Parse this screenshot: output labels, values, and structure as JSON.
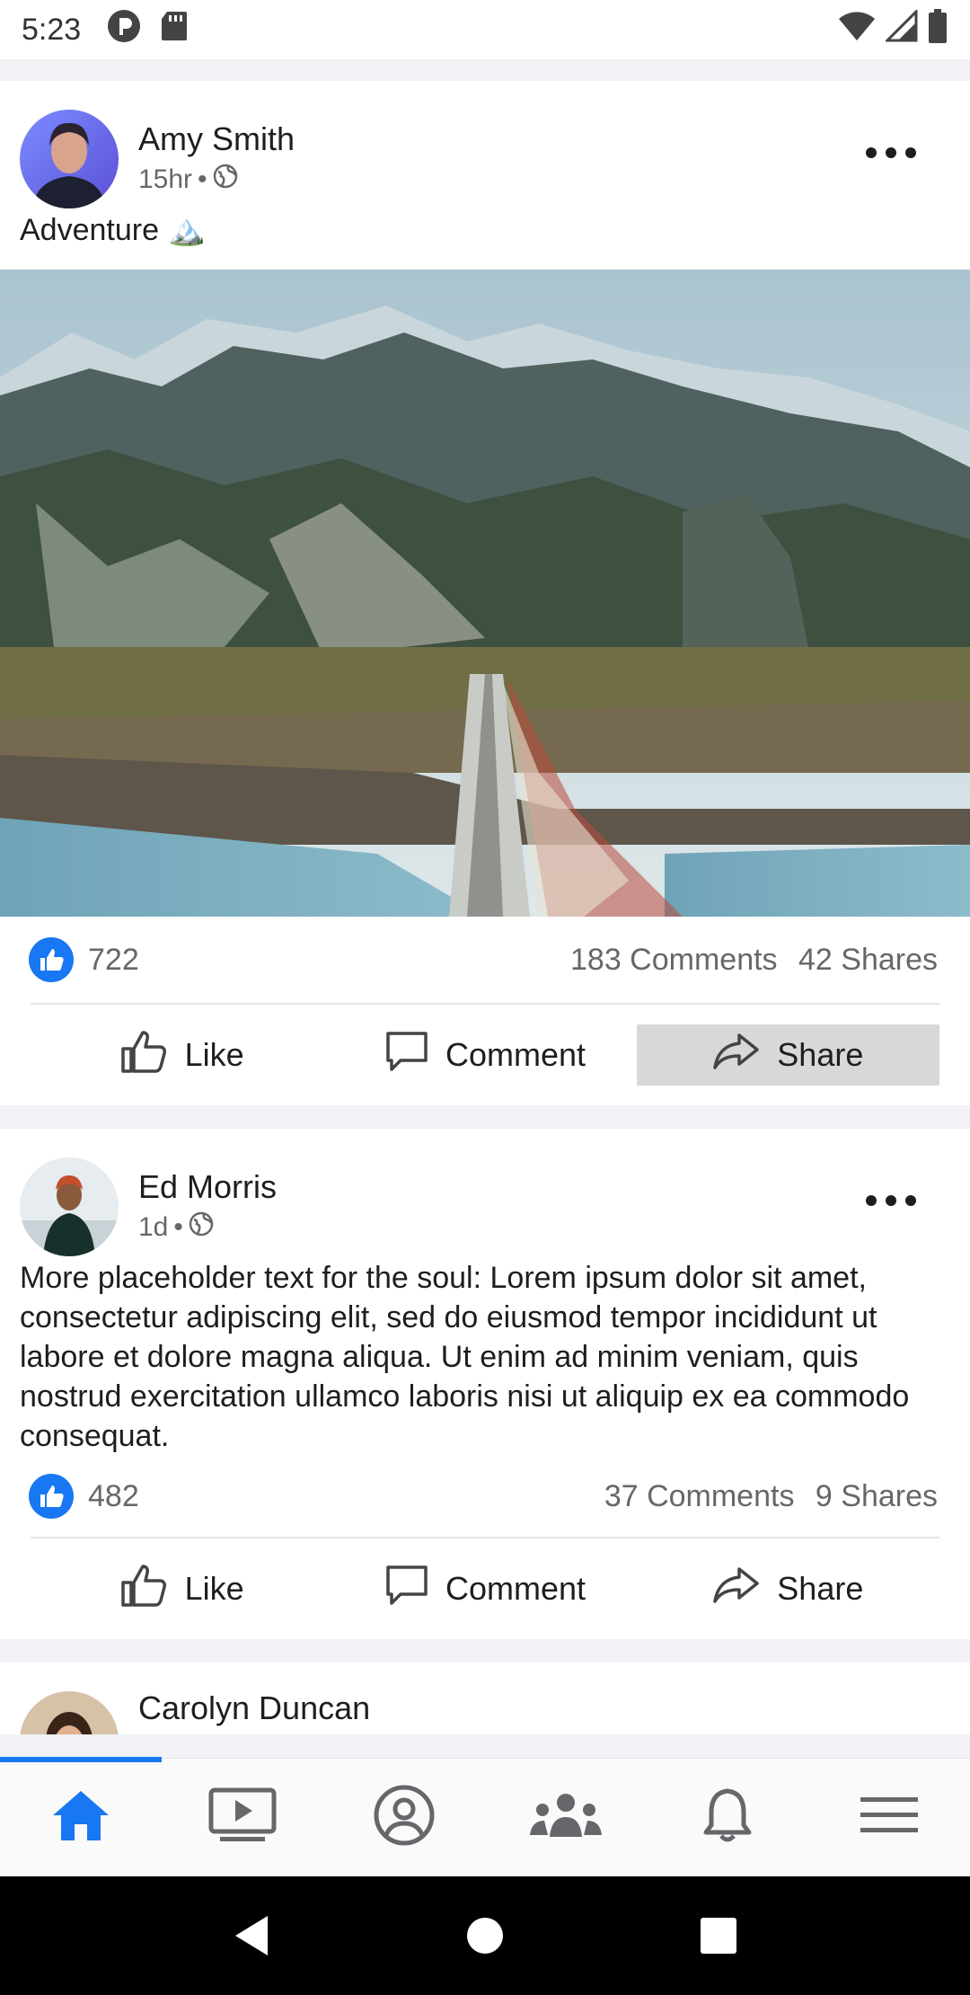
{
  "status_bar": {
    "time": "5:23"
  },
  "posts": [
    {
      "author": "Amy Smith",
      "time": "15hr",
      "separator": "•",
      "text": "Adventure 🏔️",
      "likes": "722",
      "comments": "183 Comments",
      "shares": "42 Shares",
      "actions": {
        "like": "Like",
        "comment": "Comment",
        "share": "Share"
      }
    },
    {
      "author": "Ed Morris",
      "time": "1d",
      "separator": "•",
      "text": "More placeholder text for the soul: Lorem ipsum dolor sit amet, consectetur adipiscing elit, sed do eiusmod tempor incididunt ut labore et dolore magna aliqua. Ut enim ad minim veniam, quis nostrud exercitation ullamco laboris nisi ut aliquip ex ea commodo consequat.",
      "likes": "482",
      "comments": "37 Comments",
      "shares": "9 Shares",
      "actions": {
        "like": "Like",
        "comment": "Comment",
        "share": "Share"
      }
    },
    {
      "author": "Carolyn Duncan"
    }
  ],
  "bottom_nav": {
    "items": [
      "home-icon",
      "video-icon",
      "profile-icon",
      "groups-icon",
      "notifications-icon",
      "menu-icon"
    ],
    "active": "home-icon"
  },
  "colors": {
    "accent": "#1877f2",
    "text": "#1c1e21",
    "secondary": "#65676b"
  }
}
